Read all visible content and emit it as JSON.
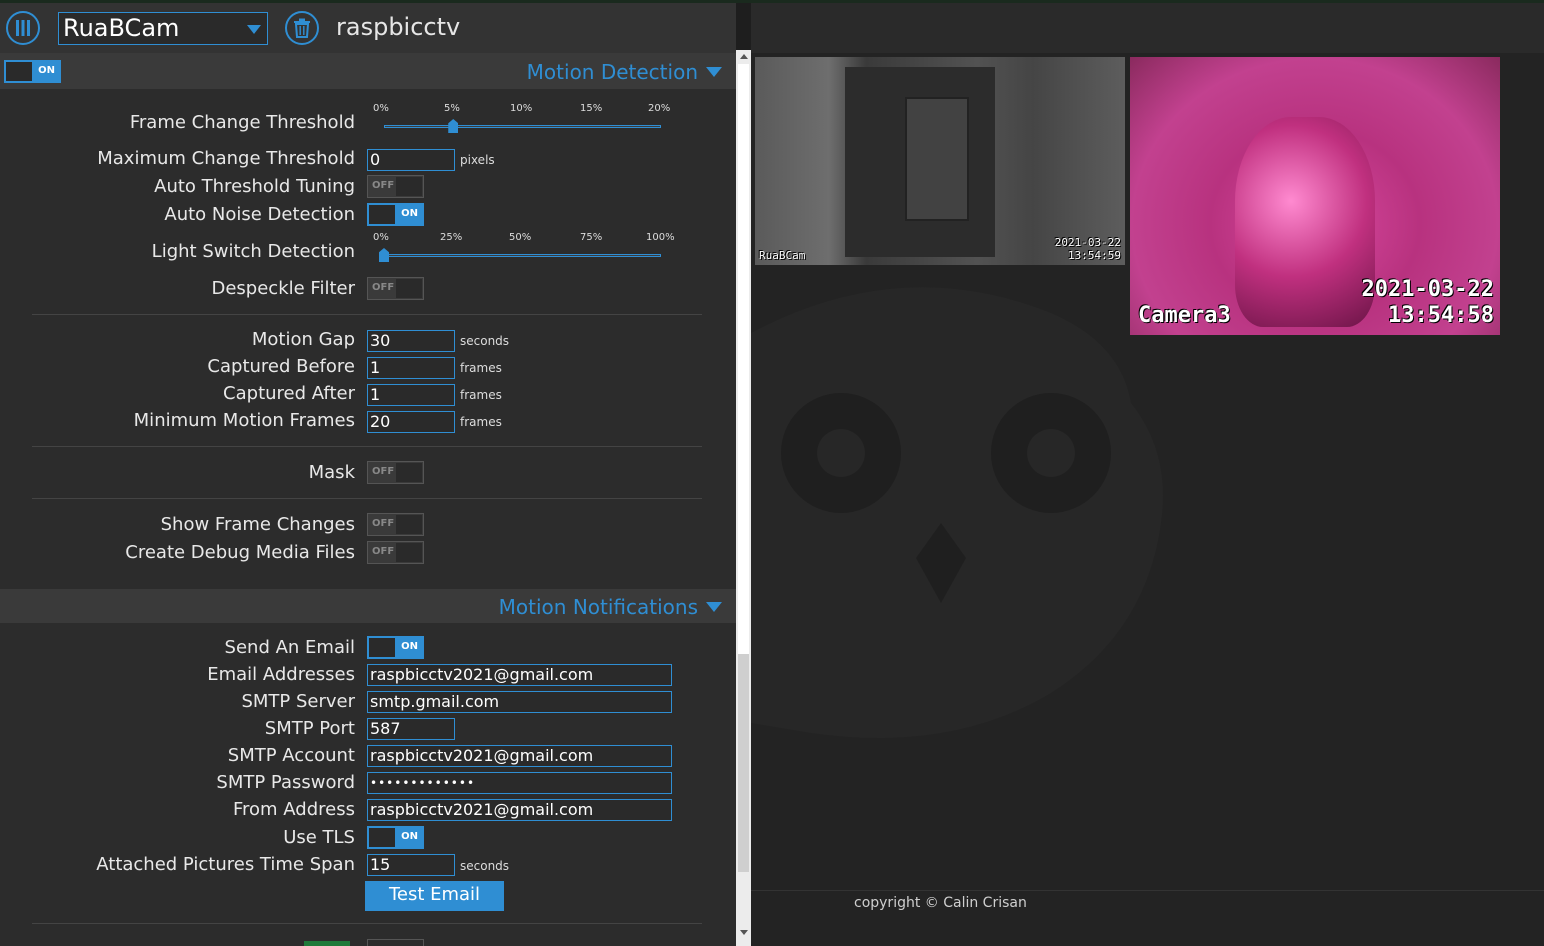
{
  "header": {
    "camera_select": "RuaBCam",
    "camera_title": "raspbicctv"
  },
  "motion_detection": {
    "enabled_label": "ON",
    "section_title": "Motion Detection",
    "frame_change_threshold": {
      "label": "Frame Change Threshold",
      "ticks": [
        "0%",
        "5%",
        "10%",
        "15%",
        "20%"
      ],
      "value_percent": 5,
      "max_percent": 20
    },
    "maximum_change_threshold": {
      "label": "Maximum Change Threshold",
      "value": "0",
      "unit": "pixels"
    },
    "auto_threshold_tuning": {
      "label": "Auto Threshold Tuning",
      "state": "OFF"
    },
    "auto_noise_detection": {
      "label": "Auto Noise Detection",
      "state": "ON"
    },
    "light_switch_detection": {
      "label": "Light Switch Detection",
      "ticks": [
        "0%",
        "25%",
        "50%",
        "75%",
        "100%"
      ],
      "value_percent": 0,
      "max_percent": 100
    },
    "despeckle_filter": {
      "label": "Despeckle Filter",
      "state": "OFF"
    },
    "motion_gap": {
      "label": "Motion Gap",
      "value": "30",
      "unit": "seconds"
    },
    "captured_before": {
      "label": "Captured Before",
      "value": "1",
      "unit": "frames"
    },
    "captured_after": {
      "label": "Captured After",
      "value": "1",
      "unit": "frames"
    },
    "minimum_motion_frames": {
      "label": "Minimum Motion Frames",
      "value": "20",
      "unit": "frames"
    },
    "mask": {
      "label": "Mask",
      "state": "OFF"
    },
    "show_frame_changes": {
      "label": "Show Frame Changes",
      "state": "OFF"
    },
    "create_debug_media_files": {
      "label": "Create Debug Media Files",
      "state": "OFF"
    }
  },
  "motion_notifications": {
    "section_title": "Motion Notifications",
    "send_an_email": {
      "label": "Send An Email",
      "state": "ON"
    },
    "email_addresses": {
      "label": "Email Addresses",
      "value": "raspbicctv2021@gmail.com"
    },
    "smtp_server": {
      "label": "SMTP Server",
      "value": "smtp.gmail.com"
    },
    "smtp_port": {
      "label": "SMTP Port",
      "value": "587"
    },
    "smtp_account": {
      "label": "SMTP Account",
      "value": "raspbicctv2021@gmail.com"
    },
    "smtp_password": {
      "label": "SMTP Password",
      "value": "•••••••••••••"
    },
    "from_address": {
      "label": "From Address",
      "value": "raspbicctv2021@gmail.com"
    },
    "use_tls": {
      "label": "Use TLS",
      "state": "ON"
    },
    "attached_pictures_time_span": {
      "label": "Attached Pictures Time Span",
      "value": "15",
      "unit": "seconds"
    },
    "test_email_button": "Test Email"
  },
  "cameras": [
    {
      "name": "RuaBCam",
      "date": "2021-03-22",
      "time": "13:54:59"
    },
    {
      "name": "Camera3",
      "date": "2021-03-22",
      "time": "13:54:58"
    }
  ],
  "footer": {
    "copyright": "copyright © Calin Crisan"
  },
  "colors": {
    "accent": "#2f8ed3",
    "panel_bg": "#2c2c2c",
    "page_bg": "#1e1e1e"
  }
}
